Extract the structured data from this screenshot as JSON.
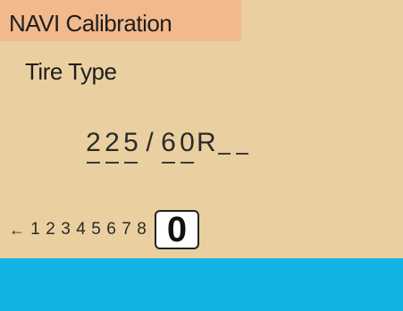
{
  "header": {
    "title": "NAVI Calibration"
  },
  "field": {
    "label": "Tire Type"
  },
  "tire_value": {
    "chars": [
      {
        "ch": "2",
        "underline": true,
        "blank": false
      },
      {
        "ch": "2",
        "underline": true,
        "blank": false
      },
      {
        "ch": "5",
        "underline": true,
        "blank": false
      },
      {
        "ch": "/",
        "underline": false,
        "blank": false
      },
      {
        "ch": "6",
        "underline": true,
        "blank": false
      },
      {
        "ch": "0",
        "underline": true,
        "blank": false
      },
      {
        "ch": "R",
        "underline": false,
        "blank": false
      },
      {
        "ch": "",
        "underline": false,
        "blank": true
      },
      {
        "ch": "",
        "underline": false,
        "blank": true
      }
    ]
  },
  "keypad": {
    "back_symbol": "←",
    "digits": [
      "1",
      "2",
      "3",
      "4",
      "5",
      "6",
      "7",
      "8"
    ],
    "selected": "0"
  },
  "colors": {
    "background": "#ead0a0",
    "title_bar": "#f2ba8c",
    "footer_bar": "#12b3e3"
  }
}
